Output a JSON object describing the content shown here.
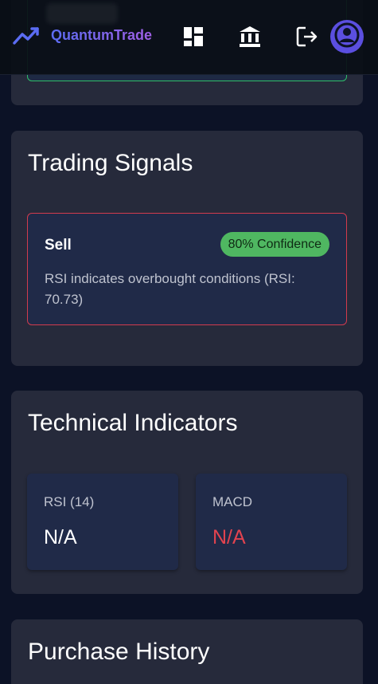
{
  "header": {
    "brand_name": "QuantumTrade",
    "icons": [
      "trend-up-icon",
      "dashboard-icon",
      "bank-icon",
      "logout-icon",
      "user-avatar-icon"
    ],
    "brand_color": "#5b6cf3",
    "avatar_color": "#5b4fe0"
  },
  "trading_signals": {
    "title": "Trading Signals",
    "signal": {
      "type": "Sell",
      "confidence": "80% Confidence",
      "description": "RSI indicates overbought conditions (RSI: 70.73)",
      "border_color": "#d23b4d",
      "badge_color": "#4fb761"
    }
  },
  "technical_indicators": {
    "title": "Technical Indicators",
    "items": [
      {
        "label": "RSI (14)",
        "value": "N/A",
        "value_color": "#ffffff"
      },
      {
        "label": "MACD",
        "value": "N/A",
        "value_color": "#e2434f"
      }
    ]
  },
  "purchase_history": {
    "title": "Purchase History"
  }
}
